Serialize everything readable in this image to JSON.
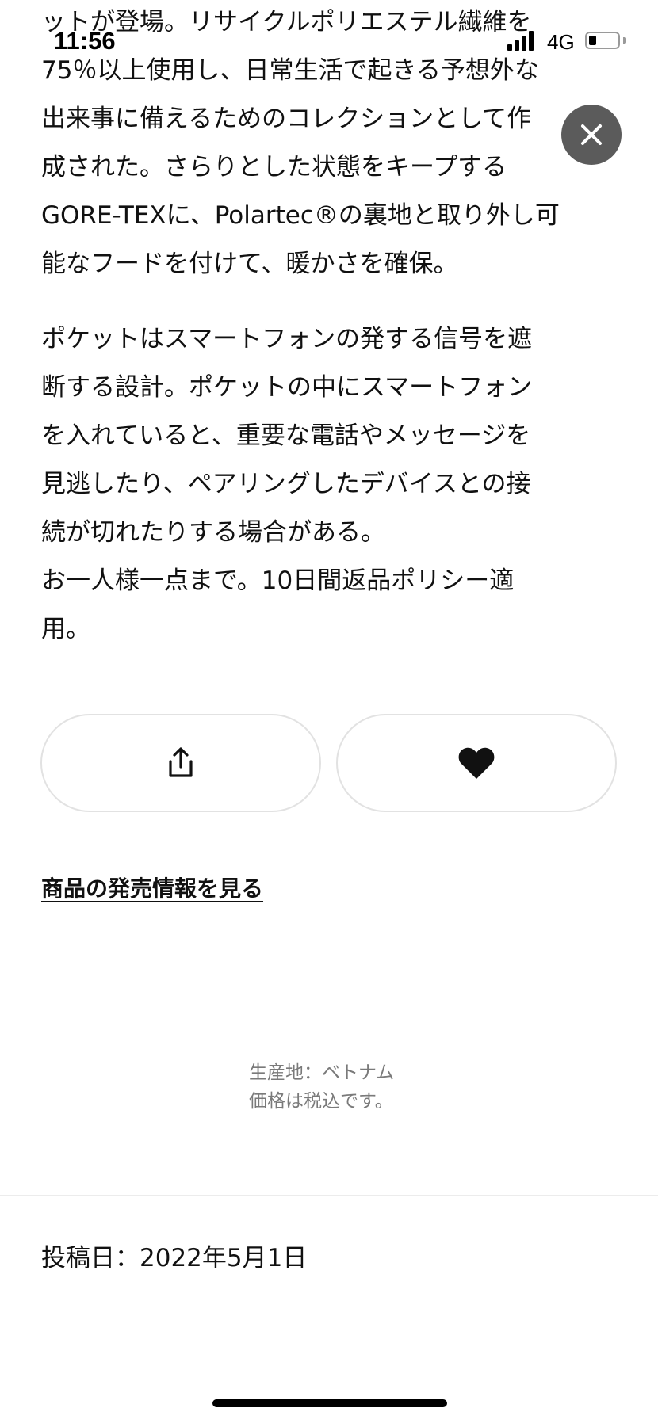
{
  "status_bar": {
    "time": "11:56",
    "network": "4G"
  },
  "description": {
    "paragraph1": [
      "ットが登場。リサイクルポリエステル繊維を",
      "75％以上使用し、日常生活で起きる予想外な",
      "出来事に備えるためのコレクションとして作",
      "成された。さらりとした状態をキープする",
      "GORE-TEXに、Polartec®の裏地と取り外し可",
      "能なフードを付けて、暖かさを確保。"
    ],
    "paragraph2": [
      "ポケットはスマートフォンの発する信号を遮",
      "断する設計。ポケットの中にスマートフォン",
      "を入れていると、重要な電話やメッセージを",
      "見逃したり、ペアリングしたデバイスとの接",
      "続が切れたりする場合がある。",
      "お一人様一点まで。10日間返品ポリシー適",
      "用。"
    ]
  },
  "actions": {
    "share_icon": "share-icon",
    "favorite_icon": "heart-icon"
  },
  "release_link": "商品の発売情報を見る",
  "product_info": {
    "origin": "生産地：ベトナム",
    "tax_note": "価格は税込です。"
  },
  "post_date": "投稿日：2022年5月1日",
  "colors": {
    "close_button_bg": "#5b5b5b",
    "text": "#111111",
    "muted_text": "#7a7a7a",
    "button_border": "#e2e2e2"
  }
}
